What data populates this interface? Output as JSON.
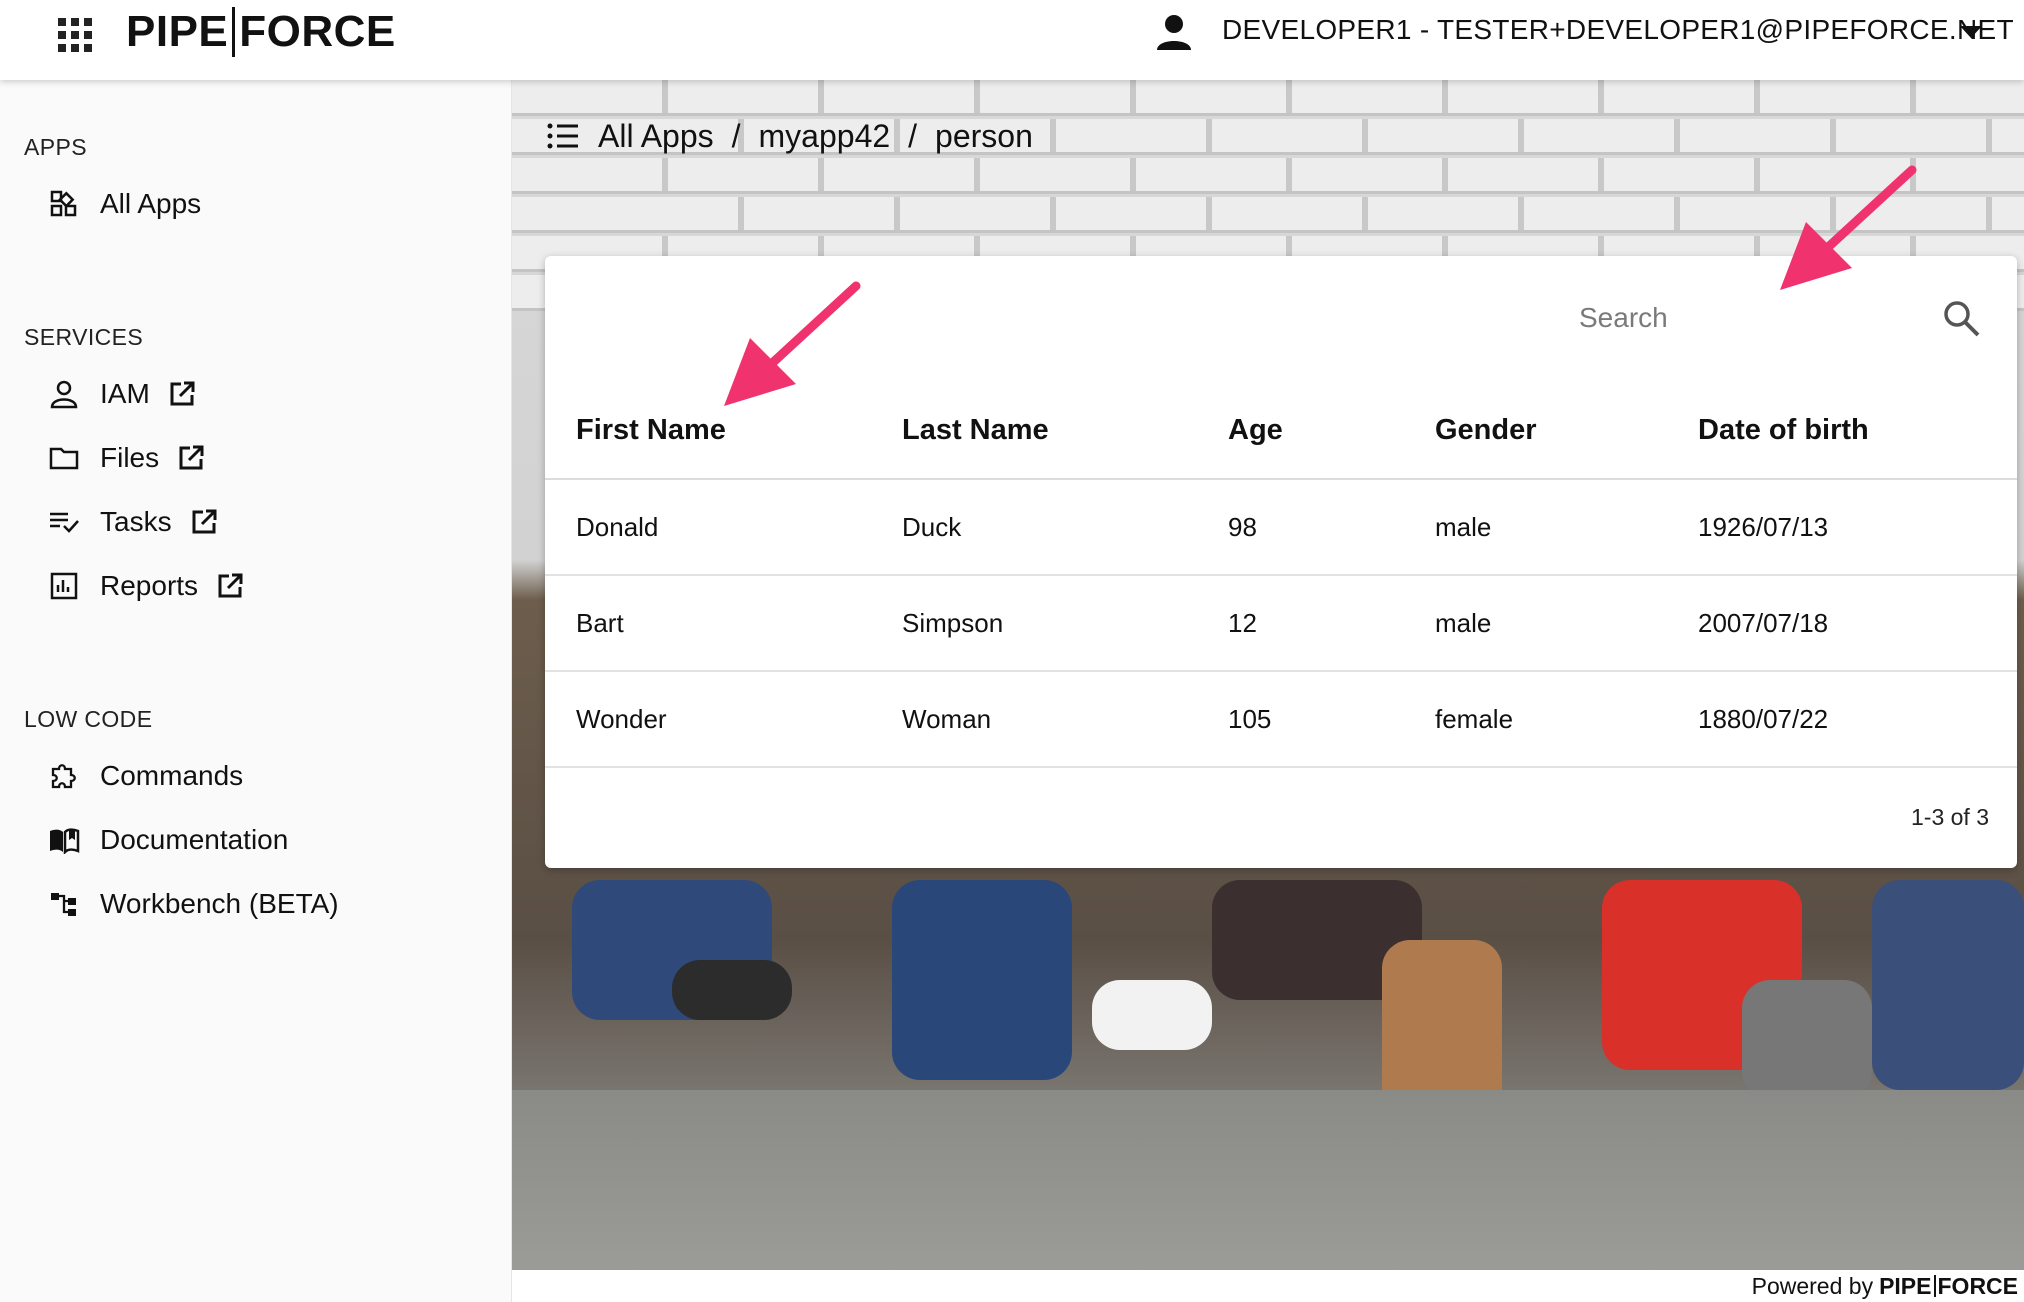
{
  "header": {
    "logo_left": "PIPE",
    "logo_right": "FORCE",
    "user_label": "DEVELOPER1 - TESTER+DEVELOPER1@PIPEFORCE.NET",
    "icons": [
      "apps-grid-icon",
      "account-icon",
      "caret-down-icon"
    ]
  },
  "sidebar": {
    "sections": [
      {
        "title": "APPS",
        "items": [
          {
            "label": "All Apps",
            "icon": "dashboard-icon",
            "external": false
          }
        ]
      },
      {
        "title": "SERVICES",
        "items": [
          {
            "label": "IAM",
            "icon": "person-icon",
            "external": true
          },
          {
            "label": "Files",
            "icon": "folder-icon",
            "external": true
          },
          {
            "label": "Tasks",
            "icon": "playlist-check-icon",
            "external": true
          },
          {
            "label": "Reports",
            "icon": "chart-icon",
            "external": true
          }
        ]
      },
      {
        "title": "LOW CODE",
        "items": [
          {
            "label": "Commands",
            "icon": "puzzle-icon",
            "external": false
          },
          {
            "label": "Documentation",
            "icon": "book-icon",
            "external": false
          },
          {
            "label": "Workbench (BETA)",
            "icon": "tree-icon",
            "external": false
          }
        ]
      }
    ]
  },
  "breadcrumb": {
    "items": [
      "All Apps",
      "myapp42",
      "person"
    ],
    "separator": "/"
  },
  "table": {
    "search_placeholder": "Search",
    "columns": [
      "First Name",
      "Last Name",
      "Age",
      "Gender",
      "Date of birth"
    ],
    "rows": [
      [
        "Donald",
        "Duck",
        "98",
        "male",
        "1926/07/13"
      ],
      [
        "Bart",
        "Simpson",
        "12",
        "male",
        "2007/07/18"
      ],
      [
        "Wonder",
        "Woman",
        "105",
        "female",
        "1880/07/22"
      ]
    ],
    "pagination": "1-3 of 3"
  },
  "footer": {
    "powered_by": "Powered by",
    "logo_left": "PIPE",
    "logo_right": "FORCE"
  },
  "colors": {
    "accent_arrow": "#f0326e",
    "card_bg": "#ffffff",
    "topbar_bg": "#ffffff"
  }
}
